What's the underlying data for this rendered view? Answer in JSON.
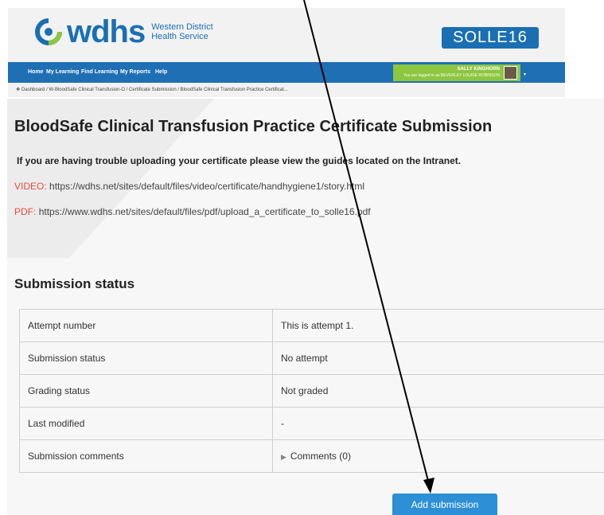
{
  "header": {
    "logo_word": "wdhs",
    "logo_sub_line1": "Western District",
    "logo_sub_line2": "Health Service",
    "badge": "SOLLE16",
    "nav": [
      "Home",
      "My Learning",
      "Find Learning",
      "My Reports",
      "Help"
    ],
    "user_name": "SALLY KINGHORN",
    "logged_in_text": "You are logged in as BEVERLEY LOUISE ROBINSON",
    "breadcrumb": "❖ Dashboard  / W-BloodSafe Clinical Transfusion-O  / Certificate Submission  / BloodSafe Clinical Transfusion Practice Certificat..."
  },
  "page": {
    "title": "BloodSafe Clinical Transfusion Practice Certificate Submission",
    "trouble_text": "If you are having trouble uploading your certificate please view the guides located on the Intranet.",
    "video_label": "VIDEO:",
    "video_url": "https://wdhs.net/sites/default/files/video/certificate/handhygiene1/story.html",
    "pdf_label": "PDF:",
    "pdf_url": "https://www.wdhs.net/sites/default/files/pdf/upload_a_certificate_to_solle16.pdf"
  },
  "submission": {
    "heading": "Submission status",
    "rows": [
      {
        "label": "Attempt number",
        "value": "This is attempt 1."
      },
      {
        "label": "Submission status",
        "value": "No attempt"
      },
      {
        "label": "Grading status",
        "value": "Not graded"
      },
      {
        "label": "Last modified",
        "value": "-"
      },
      {
        "label": "Submission comments",
        "value": "Comments (0)"
      }
    ],
    "add_button": "Add submission"
  },
  "colors": {
    "brand_blue": "#1a6fb3",
    "nav_blue": "#1f6fb4",
    "user_green": "#8dc63f",
    "link_label_red": "#e74c3c",
    "button_blue": "#2d8fd5"
  }
}
